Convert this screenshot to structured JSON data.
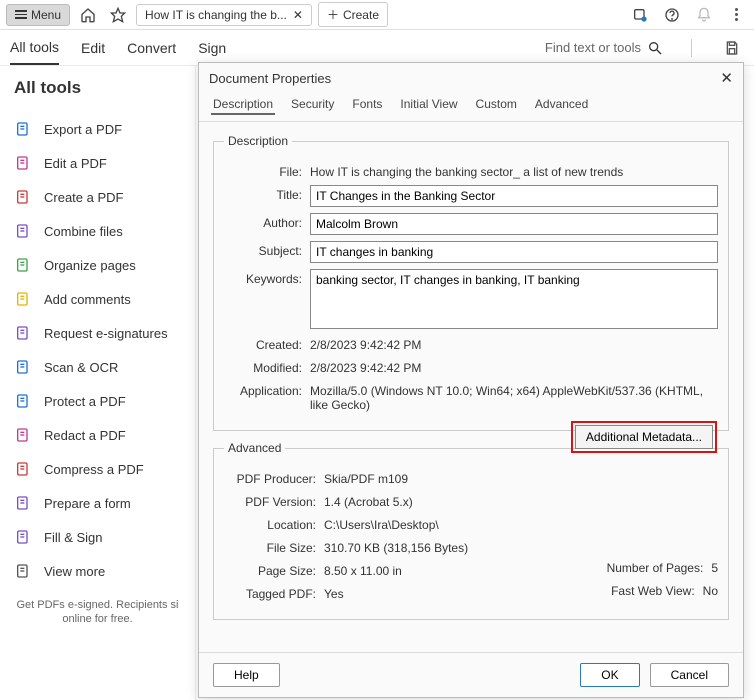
{
  "topbar": {
    "menu_label": "Menu",
    "tab_title": "How IT is changing the b...",
    "create_label": "Create"
  },
  "secondbar": {
    "all_tools": "All tools",
    "edit": "Edit",
    "convert": "Convert",
    "sign": "Sign",
    "find_placeholder": "Find text or tools"
  },
  "sidebar": {
    "heading": "All tools",
    "items": [
      {
        "label": "Export a PDF",
        "color": "#1e6fd9"
      },
      {
        "label": "Edit a PDF",
        "color": "#c1398e"
      },
      {
        "label": "Create a PDF",
        "color": "#c73b3b"
      },
      {
        "label": "Combine files",
        "color": "#7a4fbf"
      },
      {
        "label": "Organize pages",
        "color": "#3aa24a"
      },
      {
        "label": "Add comments",
        "color": "#e0b400"
      },
      {
        "label": "Request e-signatures",
        "color": "#7a4fbf"
      },
      {
        "label": "Scan & OCR",
        "color": "#1e6fd9"
      },
      {
        "label": "Protect a PDF",
        "color": "#1e6fd9"
      },
      {
        "label": "Redact a PDF",
        "color": "#c1398e"
      },
      {
        "label": "Compress a PDF",
        "color": "#c73b3b"
      },
      {
        "label": "Prepare a form",
        "color": "#7a4fbf"
      },
      {
        "label": "Fill & Sign",
        "color": "#7a4fbf"
      },
      {
        "label": "View more",
        "color": "#555"
      }
    ],
    "footer": "Get PDFs e-signed. Recipients si\nonline for free."
  },
  "dialog": {
    "title": "Document Properties",
    "tabs": [
      "Description",
      "Security",
      "Fonts",
      "Initial View",
      "Custom",
      "Advanced"
    ],
    "active_tab": "Description",
    "desc_legend": "Description",
    "file_label": "File:",
    "file_value": "How IT is changing the banking sector_ a list of new trends",
    "title_label": "Title:",
    "title_value": "IT Changes in the Banking Sector",
    "author_label": "Author:",
    "author_value": "Malcolm Brown",
    "subject_label": "Subject:",
    "subject_value": "IT changes in banking",
    "keywords_label": "Keywords:",
    "keywords_value": "banking sector, IT changes in banking, IT banking",
    "created_label": "Created:",
    "created_value": "2/8/2023 9:42:42 PM",
    "modified_label": "Modified:",
    "modified_value": "2/8/2023 9:42:42 PM",
    "application_label": "Application:",
    "application_value": "Mozilla/5.0 (Windows NT 10.0; Win64; x64) AppleWebKit/537.36 (KHTML, like Gecko)",
    "addl_meta_label": "Additional Metadata...",
    "adv_legend": "Advanced",
    "producer_label": "PDF Producer:",
    "producer_value": "Skia/PDF m109",
    "version_label": "PDF Version:",
    "version_value": "1.4 (Acrobat 5.x)",
    "location_label": "Location:",
    "location_value": "C:\\Users\\Ira\\Desktop\\",
    "filesize_label": "File Size:",
    "filesize_value": "310.70 KB (318,156 Bytes)",
    "pagesize_label": "Page Size:",
    "pagesize_value": "8.50 x 11.00 in",
    "numpages_label": "Number of Pages:",
    "numpages_value": "5",
    "tagged_label": "Tagged PDF:",
    "tagged_value": "Yes",
    "fastweb_label": "Fast Web View:",
    "fastweb_value": "No",
    "help_label": "Help",
    "ok_label": "OK",
    "cancel_label": "Cancel"
  }
}
